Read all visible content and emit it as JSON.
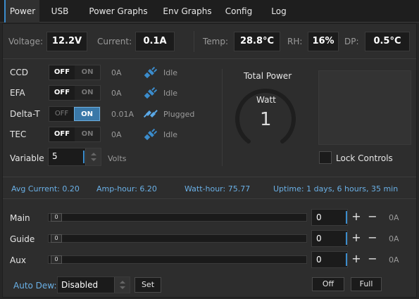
{
  "tabs": [
    {
      "label": "Power",
      "active": true
    },
    {
      "label": "USB"
    },
    {
      "label": "Power Graphs"
    },
    {
      "label": "Env Graphs"
    },
    {
      "label": "Config"
    },
    {
      "label": "Log"
    }
  ],
  "readings": {
    "voltage_label": "Voltage:",
    "voltage": "12.2V",
    "current_label": "Current:",
    "current": "0.1A",
    "temp_label": "Temp:",
    "temp": "28.8°C",
    "rh_label": "RH:",
    "rh": "16%",
    "dp_label": "DP:",
    "dp": "0.5°C"
  },
  "outputs": [
    {
      "name": "CCD",
      "off": "OFF",
      "on": "ON",
      "state_on": false,
      "amps": "0A",
      "status": "Idle"
    },
    {
      "name": "EFA",
      "off": "OFF",
      "on": "ON",
      "state_on": false,
      "amps": "0A",
      "status": "Idle"
    },
    {
      "name": "Delta-T",
      "off": "OFF",
      "on": "ON",
      "state_on": true,
      "amps": "0.01A",
      "status": "Plugged"
    },
    {
      "name": "TEC",
      "off": "OFF",
      "on": "ON",
      "state_on": false,
      "amps": "0A",
      "status": "Idle"
    }
  ],
  "variable": {
    "label": "Variable",
    "value": "5",
    "unit": "Volts"
  },
  "total_power": {
    "title": "Total Power",
    "unit": "Watt",
    "value": "1"
  },
  "lock_controls": {
    "label": "Lock Controls",
    "checked": false
  },
  "stats": {
    "avg_current": "Avg Current: 0.20",
    "amp_hour": "Amp-hour: 6.20",
    "watt_hour": "Watt-hour: 75.77",
    "uptime": "Uptime: 1 days, 6 hours, 35 min"
  },
  "dew": [
    {
      "name": "Main",
      "slider": "0",
      "value": "0",
      "amps": "0A"
    },
    {
      "name": "Guide",
      "slider": "0",
      "value": "0",
      "amps": "0A"
    },
    {
      "name": "Aux",
      "slider": "0",
      "value": "0",
      "amps": "0A"
    }
  ],
  "auto_dew": {
    "label": "Auto Dew:",
    "selected": "Disabled",
    "set": "Set"
  },
  "bottom_buttons": {
    "off": "Off",
    "full": "Full"
  },
  "colors": {
    "accent": "#3b8ccc",
    "stat_text": "#6ab0e6",
    "on_active": "#3a78a8"
  },
  "icons": {
    "plug": "plug-icon",
    "plug_connected": "plug-connected-icon"
  }
}
